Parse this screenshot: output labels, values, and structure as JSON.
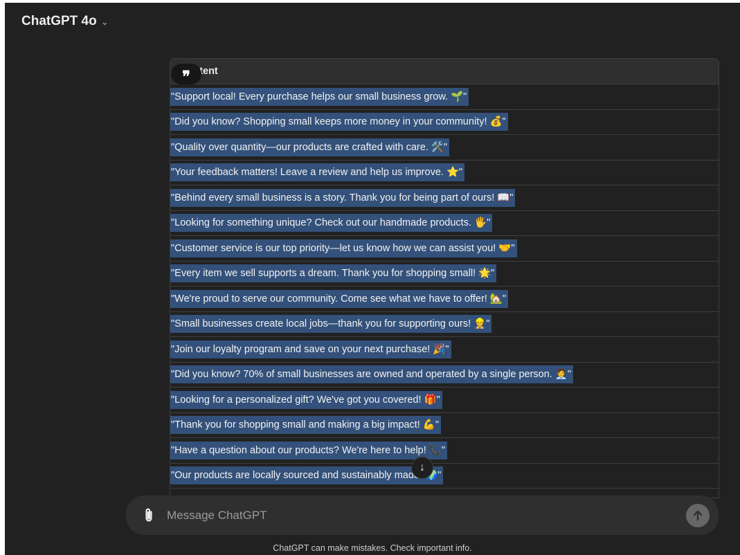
{
  "header": {
    "model_name": "ChatGPT 4o",
    "chevron": "⌄"
  },
  "table": {
    "header": "Content",
    "rows": [
      "\"Support local! Every purchase helps our small business grow. 🌱\"",
      "\"Did you know? Shopping small keeps more money in your community! 💰\"",
      "\"Quality over quantity—our products are crafted with care. 🛠️\"",
      "\"Your feedback matters! Leave a review and help us improve. ⭐\"",
      "\"Behind every small business is a story. Thank you for being part of ours! 📖\"",
      "\"Looking for something unique? Check out our handmade products. 🖐️\"",
      "\"Customer service is our top priority—let us know how we can assist you! 🤝\"",
      "\"Every item we sell supports a dream. Thank you for shopping small! 🌟\"",
      "\"We're proud to serve our community. Come see what we have to offer! 🏡\"",
      "\"Small businesses create local jobs—thank you for supporting ours! 👷\"",
      "\"Join our loyalty program and save on your next purchase! 🎉\"",
      "\"Did you know? 70% of small businesses are owned and operated by a single person. 🧑‍💼\"",
      "\"Looking for a personalized gift? We've got you covered! 🎁\"",
      "\"Thank you for shopping small and making a big impact! 💪\"",
      "\"Have a question about our products? We're here to help! 📞\"",
      "\"Our products are locally sourced and sustainably made. 🌍\""
    ]
  },
  "quote_chip": {
    "icon": "quote-icon",
    "glyph": "❞"
  },
  "scroll_button": {
    "icon": "arrow-down-icon",
    "glyph": "↓"
  },
  "composer": {
    "placeholder": "Message ChatGPT",
    "attach_icon": "paperclip-icon",
    "send_icon": "arrow-up-icon"
  },
  "disclaimer": "ChatGPT can make mistakes. Check important info.",
  "colors": {
    "background": "#212121",
    "selection": "#33517a",
    "composer": "#2f2f2f",
    "border": "#3f3f3f"
  }
}
